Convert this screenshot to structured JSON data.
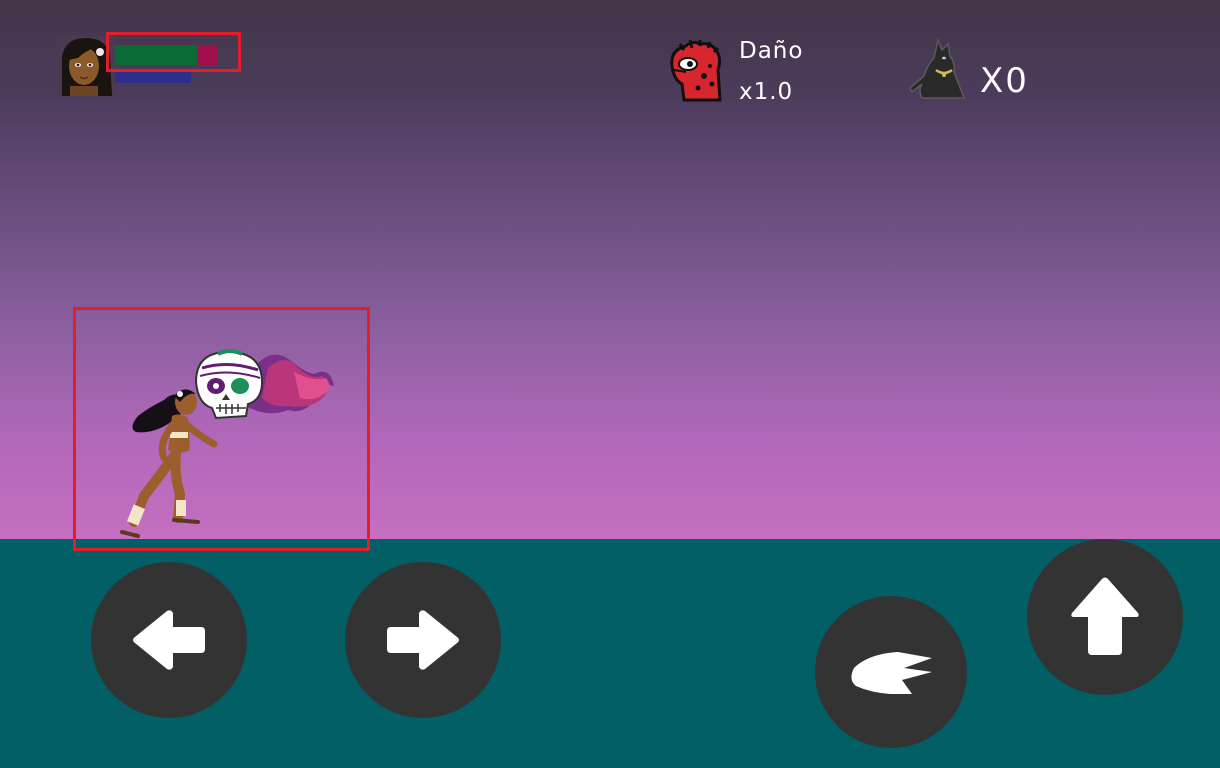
{
  "hud": {
    "player": {
      "portrait": "player-portrait",
      "health_fraction": 0.8,
      "mana_fraction": 1.0,
      "health_color": "#0c6b35",
      "health_missing_color": "#a0104d",
      "mana_color": "#2c2f8c"
    },
    "damage": {
      "label": "Daño",
      "value": "x1.0",
      "icon": "red-creature-icon"
    },
    "pets": {
      "count": "X0",
      "icon": "black-cat-icon"
    },
    "highlight_color": "#e21e2b"
  },
  "scene": {
    "sky_colors": [
      "#423548",
      "#c66fc1"
    ],
    "ground_color": "#025f66",
    "player_sprite": "running-girl",
    "companion_sprite": "sugar-skull-spirit"
  },
  "controls": {
    "move_left": "arrow-left-icon",
    "move_right": "arrow-right-icon",
    "attack": "attack-icon",
    "jump": "arrow-up-icon",
    "button_color": "#333333"
  }
}
